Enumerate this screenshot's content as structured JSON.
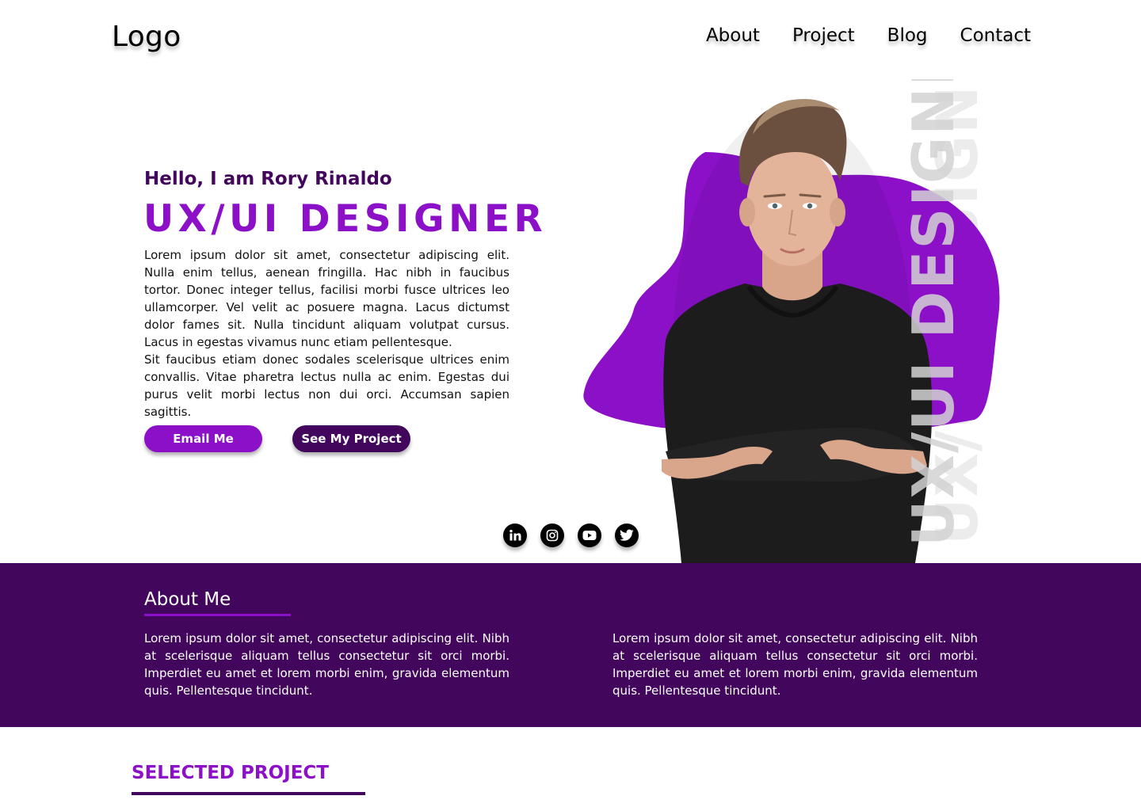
{
  "brand": {
    "logo": "Logo"
  },
  "nav": {
    "items": [
      "About",
      "Project",
      "Blog",
      "Contact"
    ]
  },
  "hero": {
    "greeting": "Hello, I am Rory Rinaldo",
    "role": "UX/UI DESIGNER",
    "paragraph1": "Lorem ipsum dolor sit amet, consectetur adipiscing elit. Nulla enim tellus, aenean fringilla. Hac nibh in faucibus tortor. Donec integer tellus, facilisi morbi fusce ultrices leo ullamcorper. Vel velit ac posuere magna. Lacus dictumst dolor fames sit. Nulla tincidunt aliquam volutpat cursus. Lacus in egestas vivamus nunc etiam pellentesque.",
    "paragraph2": "Sit faucibus etiam donec sodales scelerisque ultrices enim convallis. Vitae pharetra lectus nulla ac enim. Egestas dui purus velit morbi lectus non dui orci. Accumsan sapien sagittis.",
    "buttons": {
      "email": "Email Me",
      "project": "See My Project"
    },
    "vertical_text": "UX/UI DESIGNER",
    "socials": [
      "linkedin-icon",
      "instagram-icon",
      "youtube-icon",
      "twitter-icon"
    ]
  },
  "about": {
    "title": "About Me",
    "col_left": "Lorem ipsum dolor sit amet, consectetur adipiscing elit. Nibh at scelerisque aliquam tellus consectetur sit orci morbi. Imperdiet eu amet et lorem morbi enim, gravida elementum quis. Pellentesque tincidunt.",
    "col_right": "Lorem ipsum dolor sit amet, consectetur adipiscing elit. Nibh at scelerisque aliquam tellus consectetur sit orci morbi. Imperdiet eu amet et lorem morbi enim, gravida elementum quis. Pellentesque tincidunt."
  },
  "projects": {
    "title": "SELECTED PROJECT"
  },
  "colors": {
    "primary": "#8b10c8",
    "dark": "#42075c",
    "text": "#000000"
  }
}
